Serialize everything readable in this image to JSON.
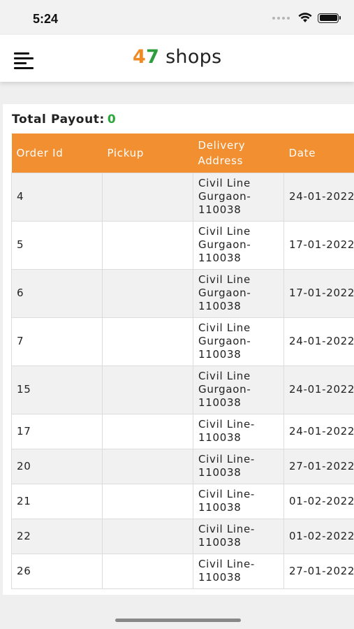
{
  "status_bar": {
    "time": "5:24"
  },
  "header": {
    "logo_digit_1": "4",
    "logo_digit_2": "7",
    "logo_text": " shops"
  },
  "payout": {
    "label": "Total Payout:",
    "value": "0"
  },
  "table": {
    "columns": [
      "Order Id",
      "Pickup",
      "Delivery Address",
      "Date"
    ],
    "rows": [
      {
        "order_id": "4",
        "pickup": "",
        "address": "Civil Line Gurgaon-110038",
        "date": "24-01-2022"
      },
      {
        "order_id": "5",
        "pickup": "",
        "address": "Civil Line Gurgaon-110038",
        "date": "17-01-2022"
      },
      {
        "order_id": "6",
        "pickup": "",
        "address": "Civil Line Gurgaon-110038",
        "date": "17-01-2022"
      },
      {
        "order_id": "7",
        "pickup": "",
        "address": "Civil Line Gurgaon-110038",
        "date": "24-01-2022"
      },
      {
        "order_id": "15",
        "pickup": "",
        "address": "Civil Line Gurgaon-110038",
        "date": "24-01-2022"
      },
      {
        "order_id": "17",
        "pickup": "",
        "address": "Civil Line-110038",
        "date": "24-01-2022"
      },
      {
        "order_id": "20",
        "pickup": "",
        "address": "Civil Line-110038",
        "date": "27-01-2022"
      },
      {
        "order_id": "21",
        "pickup": "",
        "address": "Civil Line-110038",
        "date": "01-02-2022"
      },
      {
        "order_id": "22",
        "pickup": "",
        "address": "Civil Line-110038",
        "date": "01-02-2022"
      },
      {
        "order_id": "26",
        "pickup": "",
        "address": "Civil Line-110038",
        "date": "27-01-2022"
      }
    ]
  }
}
